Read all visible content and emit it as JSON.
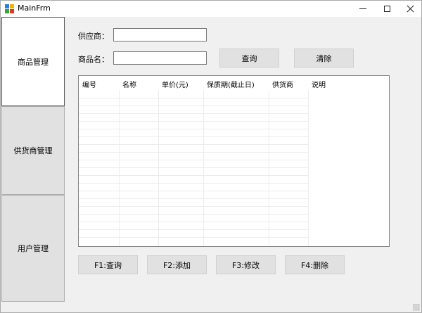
{
  "window": {
    "title": "MainFrm",
    "icon": "app-icon",
    "controls": [
      "minimize-icon",
      "maximize-icon",
      "close-icon"
    ]
  },
  "nav": {
    "items": [
      {
        "label": "商品管理",
        "active": true
      },
      {
        "label": "供货商管理",
        "active": false
      },
      {
        "label": "用户管理",
        "active": false
      }
    ]
  },
  "form": {
    "supplier_label": "供应商：",
    "supplier_value": "",
    "name_label": "商品名：",
    "name_value": "",
    "query_label": "查询",
    "clear_label": "清除"
  },
  "grid": {
    "columns": [
      "编号",
      "名称",
      "单价(元)",
      "保质期(截止日)",
      "供货商",
      "说明"
    ],
    "rows": []
  },
  "actions": {
    "f1_label": "F1:查询",
    "f2_label": "F2:添加",
    "f3_label": "F3:修改",
    "f4_label": "F4:删除"
  }
}
